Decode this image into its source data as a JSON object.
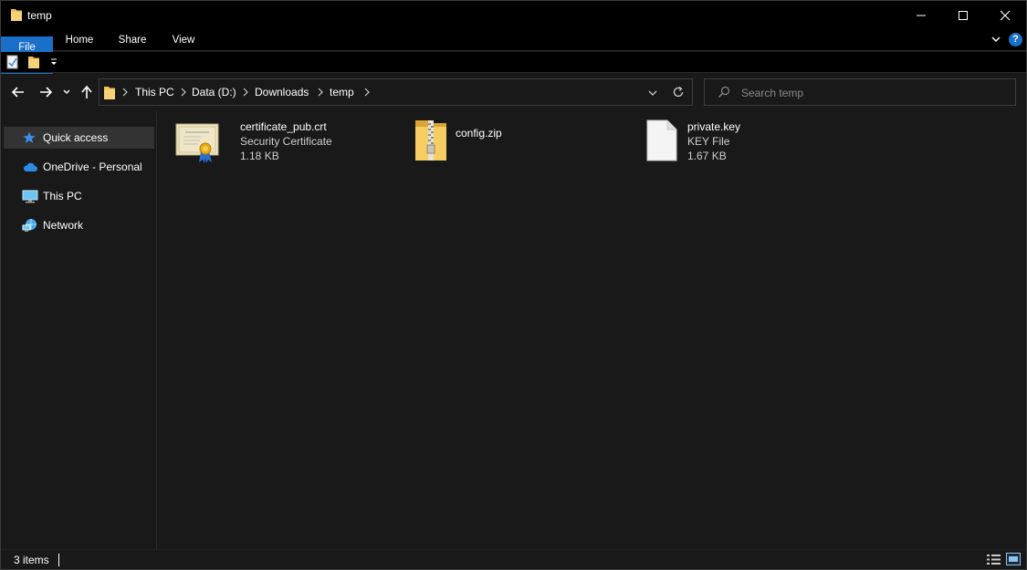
{
  "window": {
    "title": "temp"
  },
  "ribbon": {
    "tabs": [
      "File",
      "Home",
      "Share",
      "View"
    ]
  },
  "address": {
    "crumbs": [
      "This PC",
      "Data (D:)",
      "Downloads",
      "temp"
    ]
  },
  "search": {
    "placeholder": "Search temp"
  },
  "sidebar": {
    "items": [
      {
        "label": "Quick access",
        "icon": "star-icon"
      },
      {
        "label": "OneDrive - Personal",
        "icon": "cloud-icon"
      },
      {
        "label": "This PC",
        "icon": "computer-icon"
      },
      {
        "label": "Network",
        "icon": "network-icon"
      }
    ]
  },
  "files": [
    {
      "name": "certificate_pub.crt",
      "type": "Security Certificate",
      "size": "1.18 KB",
      "icon": "certificate-icon"
    },
    {
      "name": "config.zip",
      "type": "",
      "size": "",
      "icon": "zip-folder-icon"
    },
    {
      "name": "private.key",
      "type": "KEY File",
      "size": "1.67 KB",
      "icon": "blank-file-icon"
    }
  ],
  "status": {
    "item_count": "3 items"
  },
  "colors": {
    "accent": "#1a6fc9",
    "background": "#191919",
    "chrome": "#000000",
    "folder": "#f2c14e"
  }
}
